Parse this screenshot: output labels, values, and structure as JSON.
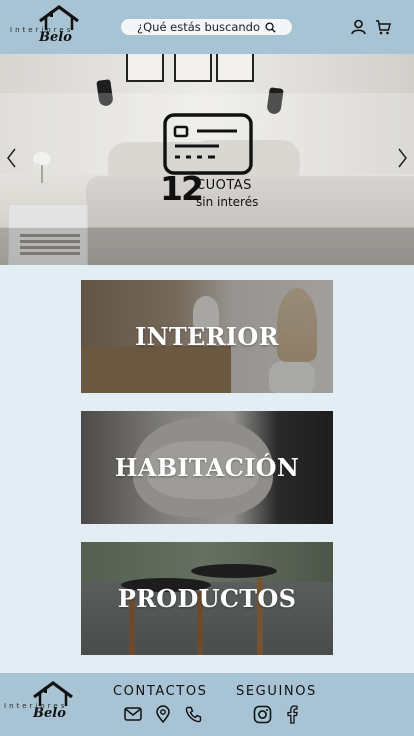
{
  "header": {
    "logo": {
      "small_text": "Interiores",
      "script_text": "Belo"
    },
    "search": {
      "placeholder": "¿Qué estás buscando?"
    },
    "icons": [
      "user-icon",
      "cart-icon",
      "search-icon"
    ]
  },
  "hero": {
    "promo": {
      "number": "12",
      "line1": "CUOTAS",
      "line2": "sin interés"
    },
    "controls": [
      "chevron-left-icon",
      "chevron-right-icon"
    ]
  },
  "categories": [
    {
      "label": "INTERIOR"
    },
    {
      "label": "HABITACIÓN"
    },
    {
      "label": "PRODUCTOS"
    }
  ],
  "footer": {
    "logo": {
      "small_text": "Interiores",
      "script_text": "Belo"
    },
    "contactos": {
      "title": "CONTACTOS",
      "icons": [
        "mail-icon",
        "location-icon",
        "phone-icon"
      ]
    },
    "seguinos": {
      "title": "SEGUINOS",
      "icons": [
        "instagram-icon",
        "facebook-icon"
      ]
    }
  },
  "colors": {
    "bar": "#a8c3d3",
    "page_bg": "#e3edf4",
    "search_bg": "#f2f6f9"
  }
}
